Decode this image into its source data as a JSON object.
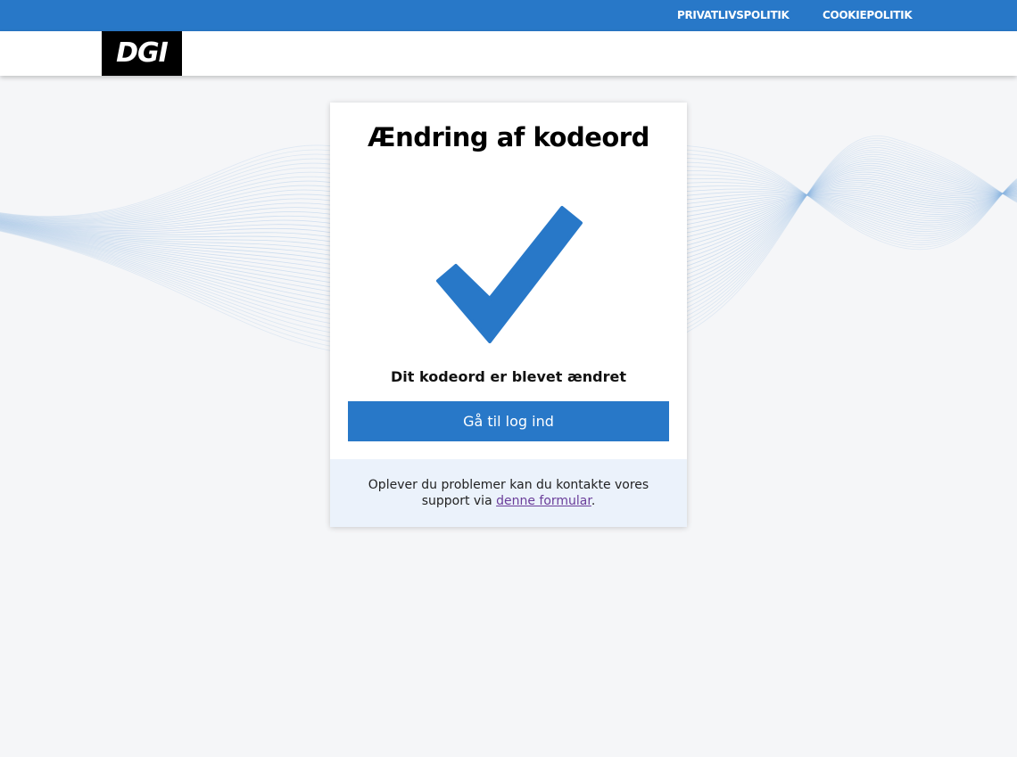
{
  "topbar": {
    "links": [
      {
        "label": "PRIVATLIVSPOLITIK"
      },
      {
        "label": "COOKIEPOLITIK"
      }
    ]
  },
  "header": {
    "logo_text": "DGI"
  },
  "card": {
    "title": "Ændring af kodeord",
    "icon": "checkmark-icon",
    "message": "Dit kodeord er blevet ændret",
    "button_label": "Gå til log ind",
    "support": {
      "text_before": "Oplever du problemer kan du kontakte vores support via ",
      "link_text": "denne formular",
      "text_after": "."
    }
  },
  "colors": {
    "brand_blue": "#2878c8",
    "page_background": "#f5f6f8",
    "support_background": "#ebf2fb",
    "link_color": "#6a3d9a"
  }
}
